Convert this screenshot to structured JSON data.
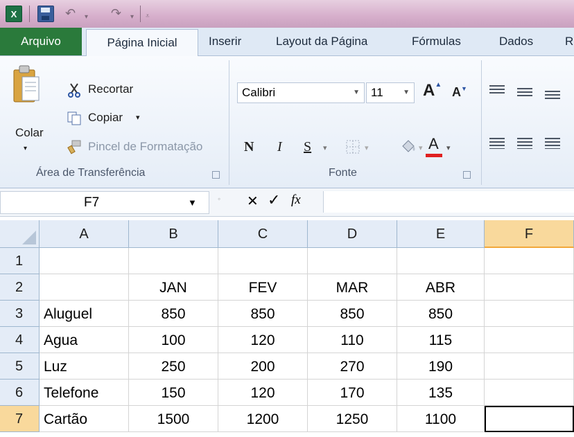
{
  "quick_access": {
    "app_icon": "excel-icon",
    "save": "save-icon",
    "undo": "undo-icon",
    "redo": "redo-icon",
    "customize": "customize-icon"
  },
  "tabs": [
    "Arquivo",
    "Página Inicial",
    "Inserir",
    "Layout da Página",
    "Fórmulas",
    "Dados",
    "R"
  ],
  "clipboard": {
    "paste_label": "Colar",
    "cut_label": "Recortar",
    "copy_label": "Copiar",
    "format_painter_label": "Pincel de Formatação",
    "group_label": "Área de Transferência"
  },
  "font": {
    "font_name": "Calibri",
    "font_size": "11",
    "bold": "N",
    "italic": "I",
    "underline": "S",
    "group_label": "Fonte",
    "font_color": "#e02020"
  },
  "formula_bar": {
    "name_box": "F7",
    "cancel": "✕",
    "enter": "✓",
    "fx": "fx",
    "value": ""
  },
  "grid": {
    "columns": [
      "A",
      "B",
      "C",
      "D",
      "E",
      "F"
    ],
    "active_column": "F",
    "rows": [
      {
        "num": "1",
        "cells": [
          "",
          "",
          "",
          "",
          "",
          ""
        ]
      },
      {
        "num": "2",
        "cells": [
          "",
          "JAN",
          "FEV",
          "MAR",
          "ABR",
          ""
        ]
      },
      {
        "num": "3",
        "cells": [
          "Aluguel",
          "850",
          "850",
          "850",
          "850",
          ""
        ]
      },
      {
        "num": "4",
        "cells": [
          "Agua",
          "100",
          "120",
          "110",
          "115",
          ""
        ]
      },
      {
        "num": "5",
        "cells": [
          "Luz",
          "250",
          "200",
          "270",
          "190",
          ""
        ]
      },
      {
        "num": "6",
        "cells": [
          "Telefone",
          "150",
          "120",
          "170",
          "135",
          ""
        ]
      },
      {
        "num": "7",
        "cells": [
          "Cartão",
          "1500",
          "1200",
          "1250",
          "1100",
          ""
        ]
      }
    ],
    "active_row": "7",
    "selected_cell": "F7"
  }
}
